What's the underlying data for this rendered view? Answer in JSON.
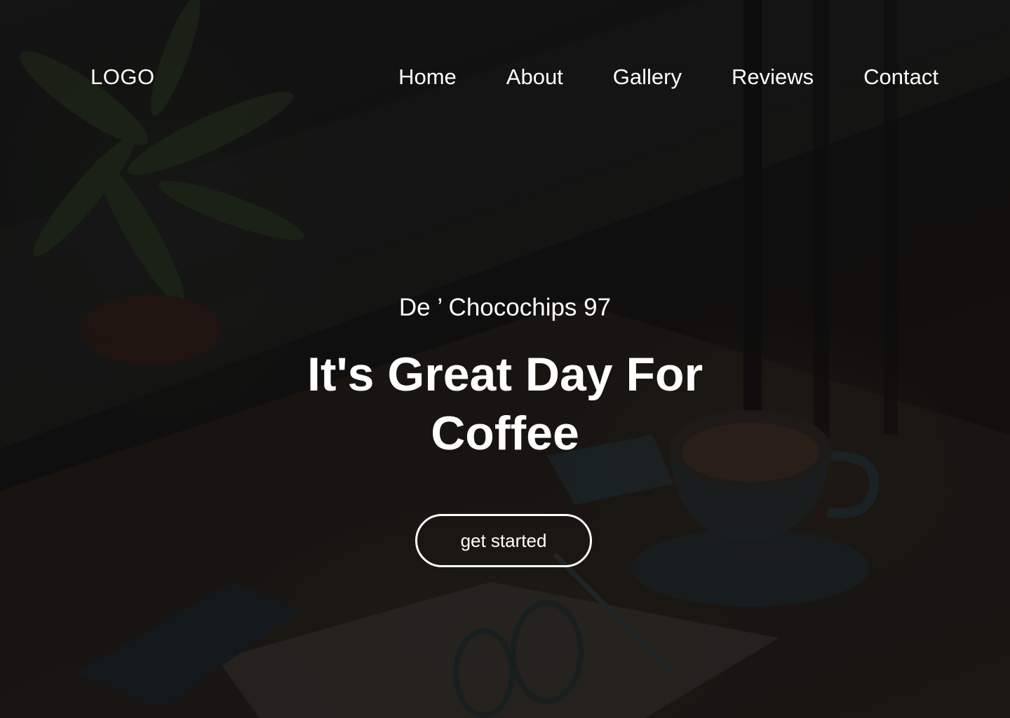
{
  "nav": {
    "logo": "LOGO",
    "links": [
      "Home",
      "About",
      "Gallery",
      "Reviews",
      "Contact"
    ]
  },
  "hero": {
    "brand": "De ’ Chocochips 97",
    "headline_line1": "It's Great Day For",
    "headline_line2": "Coffee",
    "cta_label": "get started",
    "background_description_icon": "coffee-table-photo"
  },
  "colors": {
    "text": "#ffffff",
    "background": "#141414"
  }
}
